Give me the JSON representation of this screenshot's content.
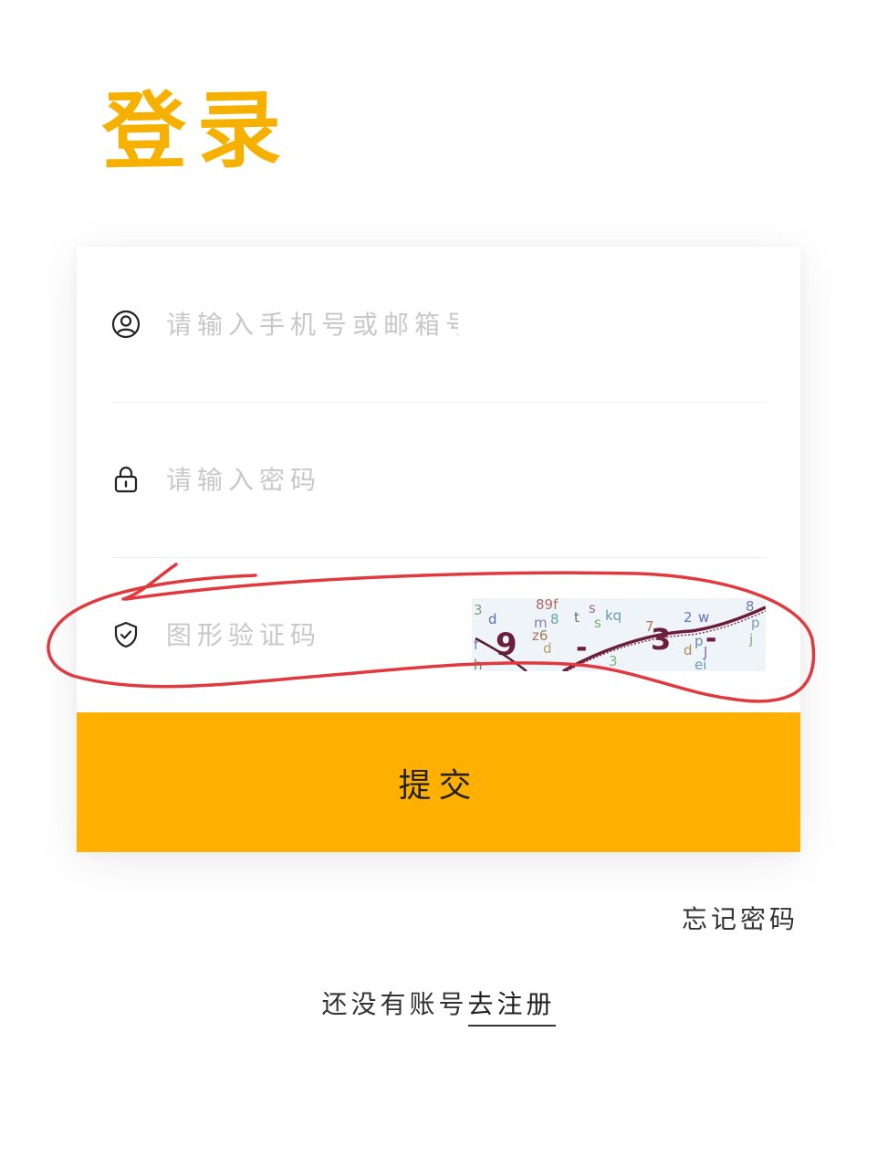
{
  "title": "登录",
  "form": {
    "account_placeholder": "请输入手机号或邮箱号",
    "password_placeholder": "请输入密码",
    "captcha_placeholder": "图形验证码",
    "submit_label": "提交"
  },
  "links": {
    "forgot_password": "忘记密码",
    "no_account_text": "还没有账号",
    "register_label": "去注册"
  },
  "icons": {
    "account": "user-icon",
    "password": "lock-icon",
    "captcha": "shield-check-icon"
  },
  "colors": {
    "accent": "#ffb000",
    "annotation": "#e0393e"
  }
}
